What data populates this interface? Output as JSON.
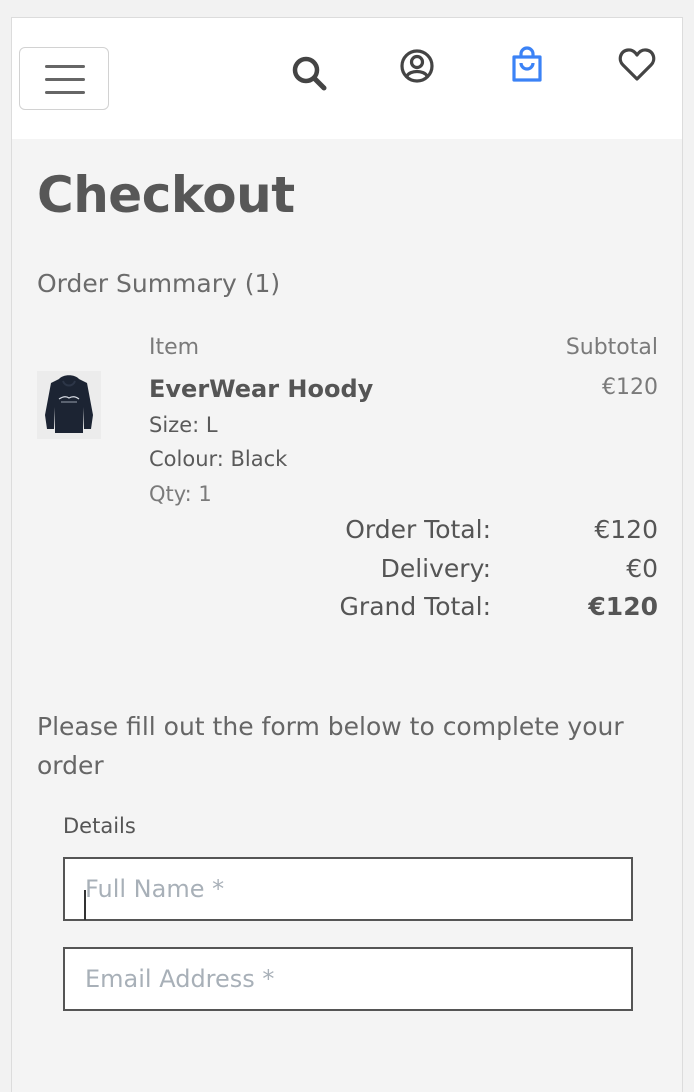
{
  "header": {
    "menu_icon": "hamburger-menu-icon",
    "search_icon": "search-icon",
    "account_icon": "user-circle-icon",
    "bag_icon": "shopping-bag-icon",
    "wishlist_icon": "heart-icon",
    "bag_color": "#3b82f6"
  },
  "page": {
    "title": "Checkout"
  },
  "summary": {
    "title": "Order Summary (1)",
    "col_item": "Item",
    "col_subtotal": "Subtotal",
    "items": [
      {
        "name": "EverWear Hoody",
        "size": "Size: L",
        "colour": "Colour: Black",
        "qty": "Qty: 1",
        "subtotal": "€120",
        "thumbnail_icon": "hoody-thumbnail-image"
      }
    ],
    "order_total_label": "Order Total:",
    "order_total": "€120",
    "delivery_label": "Delivery:",
    "delivery": "€0",
    "grand_total_label": "Grand Total:",
    "grand_total": "€120"
  },
  "form": {
    "instructions": "Please fill out the form below to complete your order",
    "details_legend": "Details",
    "full_name": {
      "value": "",
      "placeholder": "Full Name *"
    },
    "email": {
      "value": "",
      "placeholder": "Email Address *"
    }
  }
}
